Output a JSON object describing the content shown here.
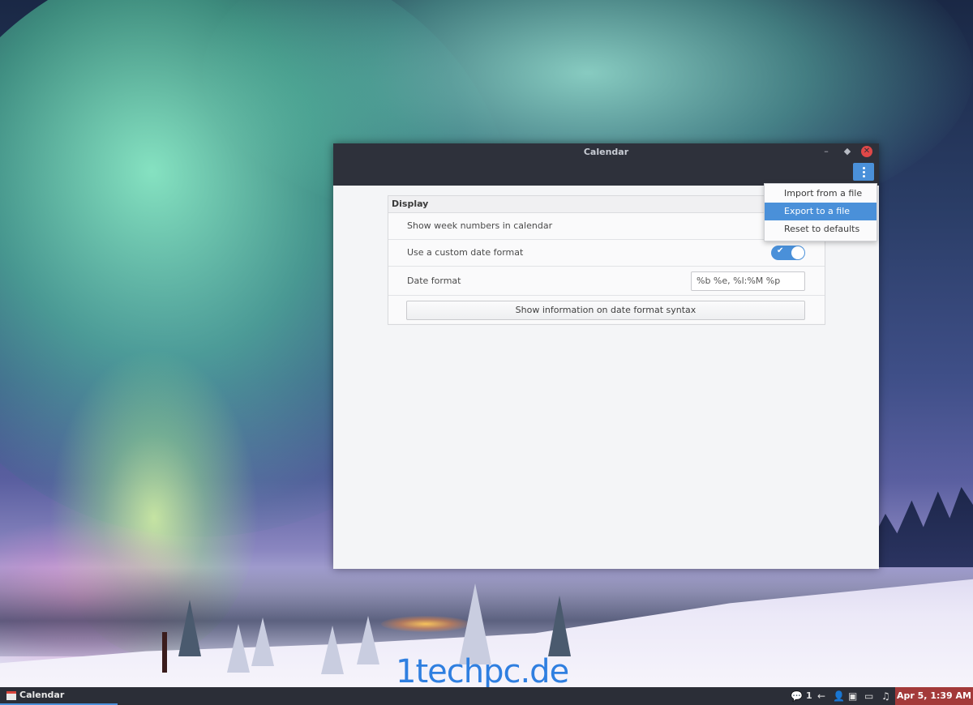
{
  "window": {
    "title": "Calendar",
    "controls": {
      "minimize": "–",
      "maximize": "◆",
      "close": "✕"
    }
  },
  "settings": {
    "section_title": "Display",
    "week_numbers_label": "Show week numbers in calendar",
    "custom_date_label": "Use a custom date format",
    "custom_date_enabled": true,
    "date_format_label": "Date format",
    "date_format_value": "%b %e, %l:%M %p",
    "syntax_button_label": "Show information on date format syntax"
  },
  "menu": {
    "items": [
      "Import from a file",
      "Export to a file",
      "Reset to defaults"
    ],
    "highlighted_index": 1
  },
  "taskbar": {
    "app_label": "Calendar",
    "notification_count": "1",
    "clock": "Apr  5,  1:39 AM"
  },
  "watermark": "1techpc.de",
  "colors": {
    "accent": "#4a90d9",
    "titlebar": "#2e313b",
    "close": "#e04848",
    "clock_bg": "#a33a3a"
  }
}
